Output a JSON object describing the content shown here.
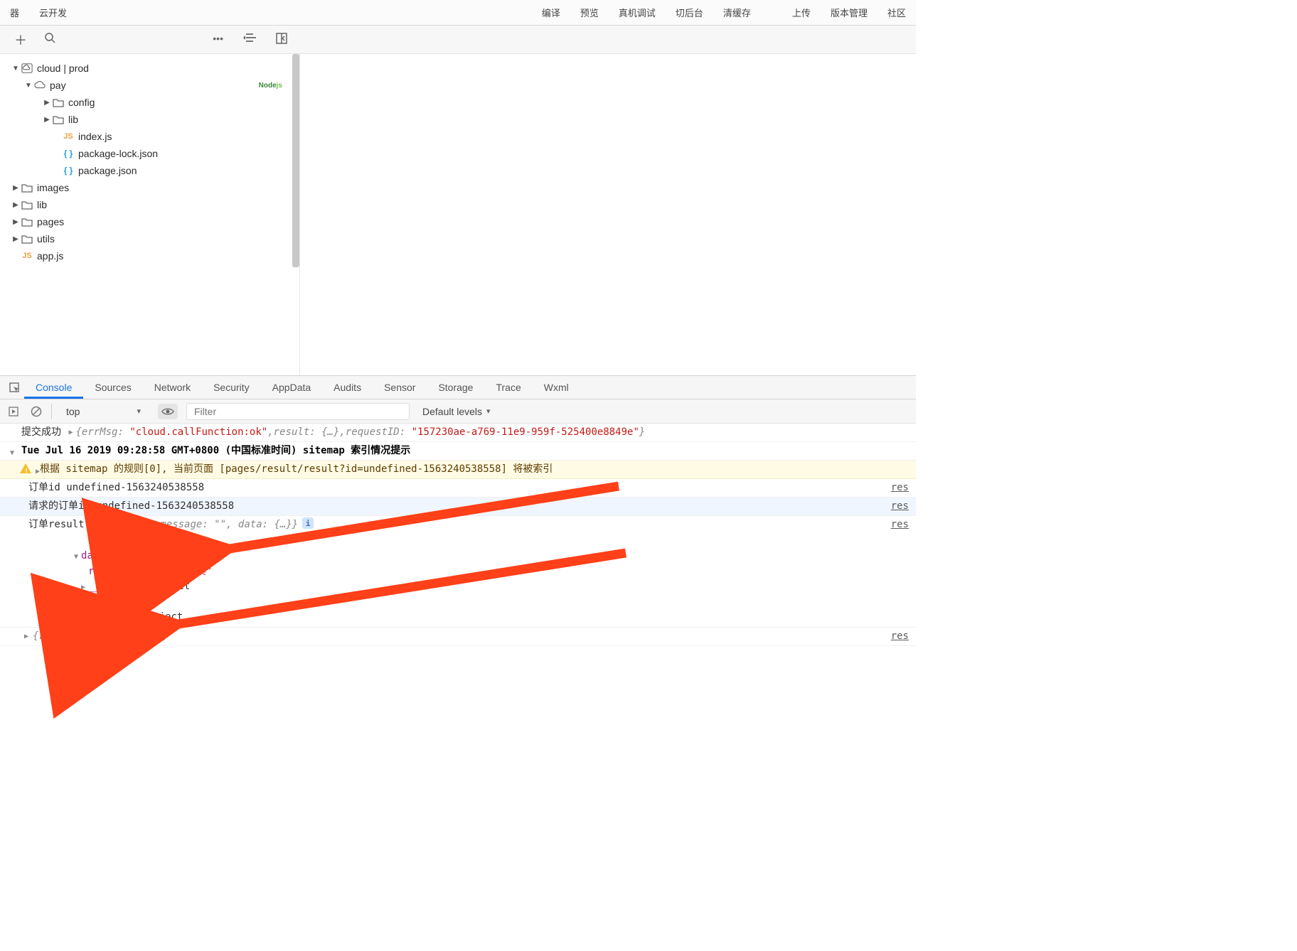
{
  "toolbar": {
    "left": [
      "器",
      "云开发"
    ],
    "right": [
      "编译",
      "预览",
      "真机调试",
      "切后台",
      "清缓存",
      "上传",
      "版本管理",
      "社区"
    ]
  },
  "file_tree": {
    "items": [
      {
        "indent": 0,
        "arrow": "down",
        "icon": "cloud-box",
        "label": "cloud | prod",
        "badge": ""
      },
      {
        "indent": 1,
        "arrow": "down",
        "icon": "cloud",
        "label": "pay",
        "badge": "Nodejs"
      },
      {
        "indent": 2,
        "arrow": "right",
        "icon": "folder",
        "label": "config"
      },
      {
        "indent": 2,
        "arrow": "right",
        "icon": "folder",
        "label": "lib"
      },
      {
        "indent": 3,
        "arrow": "",
        "icon": "js",
        "label": "index.js"
      },
      {
        "indent": 3,
        "arrow": "",
        "icon": "json",
        "label": "package-lock.json"
      },
      {
        "indent": 3,
        "arrow": "",
        "icon": "json",
        "label": "package.json"
      },
      {
        "indent": 0,
        "arrow": "right",
        "icon": "folder",
        "label": "images"
      },
      {
        "indent": 0,
        "arrow": "right",
        "icon": "folder",
        "label": "lib"
      },
      {
        "indent": 0,
        "arrow": "right",
        "icon": "folder",
        "label": "pages"
      },
      {
        "indent": 0,
        "arrow": "right",
        "icon": "folder",
        "label": "utils"
      },
      {
        "indent": 0,
        "arrow": "",
        "icon": "js",
        "label": "app.js"
      }
    ]
  },
  "devtools": {
    "tabs": [
      "Console",
      "Sources",
      "Network",
      "Security",
      "AppData",
      "Audits",
      "Sensor",
      "Storage",
      "Trace",
      "Wxml"
    ],
    "active_tab": 0,
    "context": "top",
    "filter_placeholder": "Filter",
    "levels": "Default levels"
  },
  "console": {
    "row1": {
      "prefix": "提交成功",
      "errMsg_k": "errMsg:",
      "errMsg_v": "\"cloud.callFunction:ok\"",
      "result_k": "result:",
      "result_v": "{…}",
      "requestID_k": "requestID:",
      "requestID_v": "\"157230ae-a769-11e9-959f-525400e8849e\""
    },
    "row2": "Tue Jul 16 2019 09:28:58 GMT+0800 (中国标准时间) sitemap 索引情况提示",
    "row3": "根据 sitemap 的规则[0], 当前页面 [pages/result/result?id=undefined-1563240538558] 将被索引",
    "row4": {
      "text": "订单id undefined-1563240538558",
      "src": "res"
    },
    "row5": {
      "text": "请求的订单id undefined-1563240538558",
      "src": "res"
    },
    "row6": {
      "prefix": "订单result",
      "obj": "{code: 1, message: \"\", data: {…}}",
      "src": "res",
      "code_k": "code:",
      "code_v": "1",
      "data_k": "data:",
      "ret_k": "return_msg:",
      "ret_v": "\"签名错误\"",
      "proto_k": "__proto__",
      "proto_v": ": Object",
      "msg_k": "message:",
      "msg_v": "\"\""
    },
    "row7": {
      "ret_k": "return_msg:",
      "ret_v": "\"签名错误\"",
      "src": "res"
    }
  }
}
